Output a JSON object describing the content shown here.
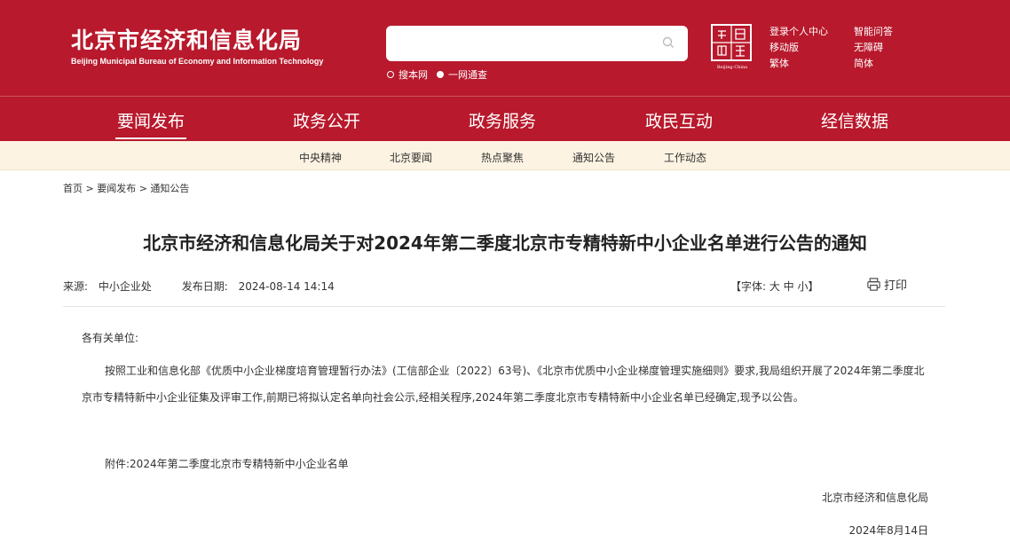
{
  "header": {
    "logo_cn": "北京市经济和信息化局",
    "logo_en": "Beijing Municipal Bureau of Economy and Information Technology",
    "search": {
      "placeholder": ""
    },
    "search_options": [
      "搜本网",
      "一网通查"
    ],
    "search_selected_index": 1,
    "seal_caption": "Beijing-China",
    "top_links": [
      "登录个人中心",
      "智能问答",
      "移动版",
      "无障碍",
      "繁体",
      "简体"
    ]
  },
  "main_nav": [
    "要闻发布",
    "政务公开",
    "政务服务",
    "政民互动",
    "经信数据"
  ],
  "sub_nav": [
    "中央精神",
    "北京要闻",
    "热点聚焦",
    "通知公告",
    "工作动态"
  ],
  "breadcrumb": "首页 > 要闻发布 > 通知公告",
  "article": {
    "title": "北京市经济和信息化局关于对2024年第二季度北京市专精特新中小企业名单进行公告的通知",
    "source_label": "来源:",
    "source_value": "中小企业处",
    "date_label": "发布日期:",
    "date_value": "2024-08-14 14:14",
    "font_size_label": "【字体: 大 中 小】",
    "print_label": "打印",
    "salutation": "各有关单位:",
    "paragraph": "按照工业和信息化部《优质中小企业梯度培育管理暂行办法》(工信部企业〔2022〕63号)、《北京市优质中小企业梯度管理实施细则》要求,我局组织开展了2024年第二季度北京市专精特新中小企业征集及评审工作,前期已将拟认定名单向社会公示,经相关程序,2024年第二季度北京市专精特新中小企业名单已经确定,现予以公告。",
    "attachment": "附件:2024年第二季度北京市专精特新中小企业名单",
    "signature_org": "北京市经济和信息化局",
    "signature_date": "2024年8月14日"
  },
  "colors": {
    "header_bg": "#b8192c",
    "subnav_bg": "#fdf3e2"
  }
}
